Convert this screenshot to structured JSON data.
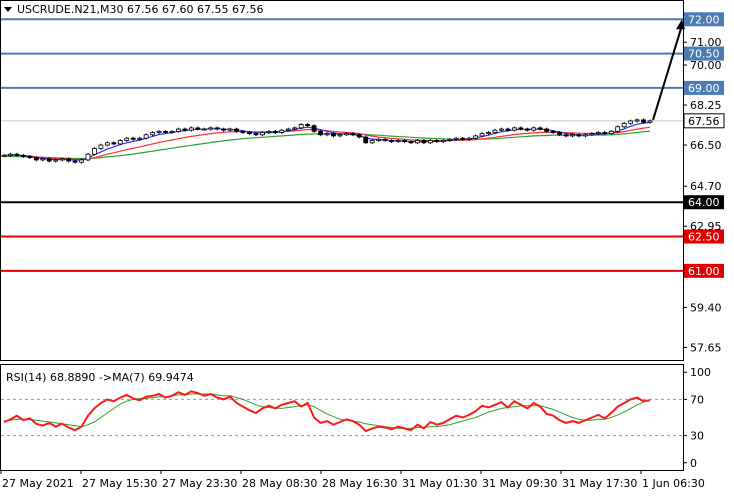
{
  "colors": {
    "blue_level": "#4a7cb3",
    "black_level": "#000000",
    "red_level": "#e00000",
    "rsi_line": "#ff1a1a",
    "rsi_ma": "#2ea02e",
    "ma_fast": "#2a35ff",
    "ma_mid": "#ff3030",
    "ma_slow": "#2ea02e",
    "grid_frame": "#000000",
    "candle": "#000000",
    "arrow": "#000000"
  },
  "header": {
    "symbol_line": "USCRUDE.N21,M30  67.56 67.60 67.55 67.56",
    "collapse_icon": "triangle-down-icon"
  },
  "rsi_header": "RSI(14) 68.8890  ->MA(7) 69.9474",
  "chart_data": [
    {
      "type": "candlestick",
      "title": "USCRUDE.N21,M30",
      "ylim": [
        57.1,
        72.8
      ],
      "y_tick_labels": [
        "71.00",
        "70.00",
        "68.25",
        "66.50",
        "64.70",
        "62.95",
        "59.40",
        "57.65"
      ],
      "y_tick_values": [
        71.0,
        70.0,
        68.25,
        66.5,
        64.7,
        62.95,
        59.4,
        57.65
      ],
      "x_tick_labels": [
        "27 May 2021",
        "27 May 15:30",
        "27 May 23:30",
        "28 May 08:30",
        "28 May 16:30",
        "31 May 01:30",
        "31 May 09:30",
        "31 May 17:30",
        "1 Jun 06:30"
      ],
      "levels": [
        {
          "label": "72.00",
          "value": 72.0,
          "color": "#4a7cb3"
        },
        {
          "label": "70.50",
          "value": 70.5,
          "color": "#4a7cb3"
        },
        {
          "label": "69.00",
          "value": 69.0,
          "color": "#4a7cb3"
        },
        {
          "label": "64.00",
          "value": 64.0,
          "color": "#000000"
        },
        {
          "label": "62.50",
          "value": 62.5,
          "color": "#e00000"
        },
        {
          "label": "61.00",
          "value": 61.0,
          "color": "#e00000"
        }
      ],
      "current_price": {
        "label": "67.56",
        "value": 67.56
      },
      "arrow": {
        "from_value": 67.6,
        "to_value": 72.0
      },
      "close_series": [
        66.05,
        66.1,
        66.05,
        66.0,
        65.95,
        65.85,
        65.9,
        65.8,
        65.85,
        65.9,
        65.8,
        65.75,
        65.85,
        66.1,
        66.35,
        66.5,
        66.6,
        66.55,
        66.7,
        66.8,
        66.75,
        66.8,
        66.95,
        67.05,
        67.1,
        67.05,
        67.1,
        67.2,
        67.15,
        67.25,
        67.2,
        67.2,
        67.25,
        67.2,
        67.15,
        67.2,
        67.1,
        67.05,
        67.0,
        66.95,
        67.05,
        67.1,
        67.05,
        67.15,
        67.2,
        67.25,
        67.4,
        67.35,
        67.1,
        66.95,
        67.0,
        66.9,
        66.95,
        67.0,
        66.95,
        66.85,
        66.6,
        66.7,
        66.75,
        66.7,
        66.65,
        66.7,
        66.65,
        66.6,
        66.7,
        66.6,
        66.7,
        66.65,
        66.7,
        66.75,
        66.8,
        66.75,
        66.8,
        66.9,
        67.0,
        67.05,
        67.15,
        67.2,
        67.15,
        67.25,
        67.2,
        67.15,
        67.25,
        67.2,
        67.1,
        67.05,
        66.95,
        66.9,
        66.95,
        66.9,
        66.95,
        67.0,
        67.05,
        67.0,
        67.1,
        67.3,
        67.45,
        67.55,
        67.6,
        67.5,
        67.56
      ],
      "ma_fast": [
        66.05,
        66.07,
        66.06,
        66.03,
        65.99,
        65.94,
        65.91,
        65.88,
        65.87,
        65.87,
        65.86,
        65.84,
        65.85,
        65.94,
        66.08,
        66.2,
        66.33,
        66.42,
        66.52,
        66.6,
        66.66,
        66.72,
        66.8,
        66.88,
        66.96,
        67.0,
        67.05,
        67.1,
        67.13,
        67.17,
        67.19,
        67.2,
        67.21,
        67.21,
        67.2,
        67.19,
        67.16,
        67.12,
        67.08,
        67.04,
        67.03,
        67.04,
        67.05,
        67.08,
        67.12,
        67.17,
        67.24,
        67.28,
        67.24,
        67.17,
        67.1,
        67.03,
        66.99,
        66.98,
        66.96,
        66.92,
        66.81,
        66.76,
        66.74,
        66.72,
        66.69,
        66.68,
        66.67,
        66.65,
        66.66,
        66.65,
        66.66,
        66.66,
        66.67,
        66.7,
        66.73,
        66.75,
        66.77,
        66.81,
        66.87,
        66.93,
        67.01,
        67.08,
        67.12,
        67.17,
        67.19,
        67.19,
        67.2,
        67.2,
        67.17,
        67.13,
        67.07,
        67.01,
        66.98,
        66.95,
        66.94,
        66.95,
        66.98,
        66.99,
        67.03,
        67.11,
        67.21,
        67.32,
        67.41,
        67.46,
        67.49
      ],
      "ma_mid": [
        66.05,
        66.06,
        66.06,
        66.04,
        66.02,
        65.98,
        65.96,
        65.93,
        65.91,
        65.9,
        65.89,
        65.87,
        65.87,
        65.89,
        65.95,
        66.02,
        66.1,
        66.16,
        66.23,
        66.3,
        66.36,
        66.42,
        66.48,
        66.55,
        66.61,
        66.67,
        66.72,
        66.78,
        66.83,
        66.88,
        66.92,
        66.96,
        67.0,
        67.03,
        67.06,
        67.08,
        67.09,
        67.09,
        67.09,
        67.08,
        67.08,
        67.08,
        67.08,
        67.09,
        67.1,
        67.12,
        67.15,
        67.18,
        67.17,
        67.15,
        67.13,
        67.1,
        67.07,
        67.05,
        67.03,
        67.0,
        66.94,
        66.89,
        66.85,
        66.82,
        66.79,
        66.77,
        66.75,
        66.73,
        66.72,
        66.71,
        66.7,
        66.69,
        66.69,
        66.7,
        66.71,
        66.71,
        66.72,
        66.74,
        66.77,
        66.8,
        66.84,
        66.88,
        66.92,
        66.96,
        66.99,
        67.01,
        67.03,
        67.05,
        67.06,
        67.06,
        67.05,
        67.04,
        67.03,
        67.02,
        67.01,
        67.01,
        67.01,
        67.01,
        67.02,
        67.05,
        67.09,
        67.14,
        67.2,
        67.24,
        67.28
      ],
      "ma_slow": [
        66.0,
        66.0,
        66.0,
        65.99,
        65.98,
        65.97,
        65.96,
        65.95,
        65.94,
        65.93,
        65.92,
        65.91,
        65.91,
        65.91,
        65.93,
        65.95,
        65.98,
        66.01,
        66.04,
        66.07,
        66.11,
        66.15,
        66.19,
        66.23,
        66.28,
        66.32,
        66.36,
        66.41,
        66.45,
        66.49,
        66.53,
        66.57,
        66.61,
        66.65,
        66.68,
        66.72,
        66.75,
        66.78,
        66.8,
        66.82,
        66.84,
        66.86,
        66.88,
        66.9,
        66.92,
        66.94,
        66.96,
        66.98,
        66.99,
        66.99,
        66.99,
        66.99,
        66.99,
        66.99,
        66.99,
        66.98,
        66.96,
        66.94,
        66.93,
        66.91,
        66.89,
        66.87,
        66.86,
        66.84,
        66.82,
        66.81,
        66.79,
        66.78,
        66.77,
        66.76,
        66.75,
        66.75,
        66.75,
        66.75,
        66.76,
        66.77,
        66.78,
        66.8,
        66.82,
        66.84,
        66.86,
        66.88,
        66.9,
        66.91,
        66.92,
        66.93,
        66.93,
        66.93,
        66.93,
        66.93,
        66.93,
        66.93,
        66.94,
        66.94,
        66.95,
        66.97,
        66.99,
        67.02,
        67.05,
        67.08,
        67.11
      ]
    },
    {
      "type": "line",
      "title": "RSI(14) 68.8890  ->MA(7) 69.9474",
      "ylim": [
        -8,
        108
      ],
      "y_tick_labels": [
        "100",
        "70",
        "30",
        "0"
      ],
      "y_tick_values": [
        100,
        70,
        30,
        0
      ],
      "guide_levels": [
        70,
        30
      ],
      "rsi": [
        45,
        48,
        52,
        47,
        49,
        43,
        41,
        44,
        40,
        43,
        39,
        36,
        40,
        52,
        60,
        66,
        70,
        68,
        72,
        75,
        71,
        69,
        73,
        74,
        76,
        72,
        74,
        78,
        75,
        79,
        77,
        74,
        76,
        72,
        70,
        73,
        66,
        62,
        58,
        55,
        60,
        63,
        60,
        64,
        66,
        68,
        62,
        66,
        50,
        44,
        46,
        42,
        45,
        48,
        46,
        42,
        35,
        38,
        40,
        39,
        37,
        40,
        38,
        36,
        42,
        38,
        45,
        42,
        44,
        48,
        52,
        50,
        53,
        57,
        63,
        61,
        64,
        67,
        61,
        68,
        64,
        60,
        66,
        62,
        54,
        52,
        47,
        44,
        46,
        44,
        47,
        50,
        53,
        49,
        55,
        62,
        66,
        70,
        72,
        68,
        69
      ],
      "rsi_ma": [
        46,
        47,
        48,
        48,
        48,
        47,
        46,
        45,
        44,
        43,
        42,
        41,
        40,
        42,
        45,
        50,
        55,
        60,
        65,
        68,
        70,
        71,
        71,
        72,
        73,
        73,
        74,
        75,
        75,
        76,
        76,
        76,
        76,
        75,
        74,
        74,
        72,
        70,
        67,
        64,
        62,
        61,
        60,
        60,
        61,
        62,
        63,
        64,
        62,
        58,
        54,
        51,
        48,
        47,
        46,
        45,
        43,
        42,
        41,
        40,
        39,
        38,
        38,
        38,
        39,
        39,
        40,
        40,
        41,
        42,
        44,
        46,
        48,
        50,
        53,
        56,
        58,
        60,
        61,
        62,
        63,
        63,
        63,
        63,
        61,
        59,
        56,
        53,
        50,
        48,
        47,
        47,
        48,
        48,
        50,
        53,
        56,
        60,
        64,
        67,
        69.9
      ]
    }
  ]
}
